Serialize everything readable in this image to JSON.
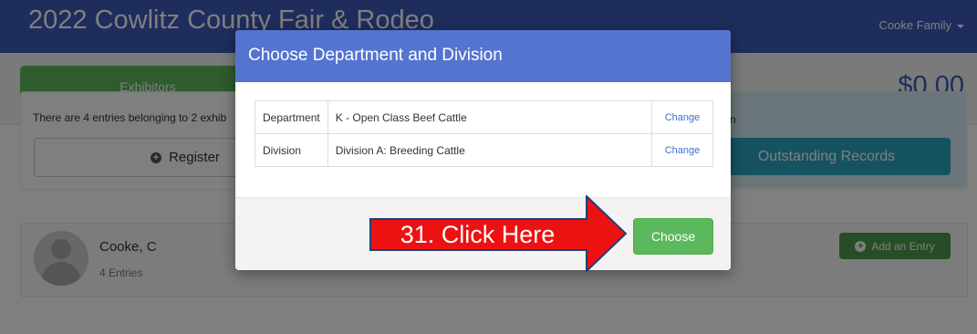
{
  "navbar": {
    "title": "2022 Cowlitz County Fair & Rodeo",
    "user": "Cooke Family"
  },
  "summary": {
    "exhibitors_label": "Exhibitors",
    "total": "$0.00"
  },
  "info": {
    "text": "There are 4 entries belonging to 2 exhib",
    "fragment": "n",
    "register_label": "Register",
    "outstanding_label": "Outstanding Records"
  },
  "exhibitor": {
    "name": "Cooke, C",
    "entries": "4 Entries",
    "add_entry_label": "Add an Entry"
  },
  "modal": {
    "title": "Choose Department and Division",
    "rows": [
      {
        "label": "Department",
        "value": "K - Open Class Beef Cattle",
        "action": "Change"
      },
      {
        "label": "Division",
        "value": "Division A: Breeding Cattle",
        "action": "Change"
      }
    ],
    "choose_label": "Choose"
  },
  "annotation": {
    "text": "31. Click Here",
    "fill_color": "#ee1111",
    "border_color": "#1f3f7a"
  },
  "colors": {
    "navbar": "#3c5bb8",
    "modal_header": "#5574cf",
    "success": "#5cb85c",
    "info": "#2aa7c2"
  }
}
